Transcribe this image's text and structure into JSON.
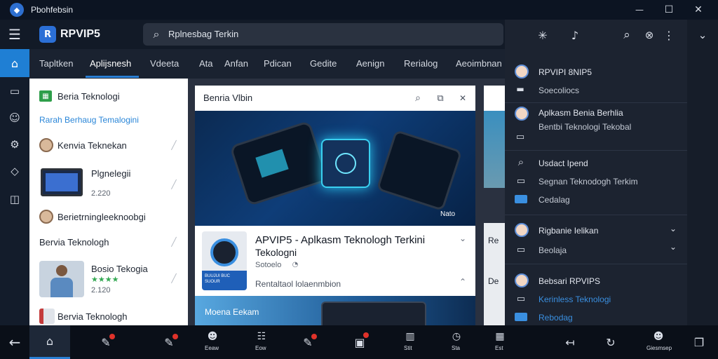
{
  "window": {
    "title": "Pbohfebsin",
    "minimize": "—",
    "maximize": "☐",
    "close": "✕"
  },
  "appbar": {
    "brand": "RPVIP5",
    "search_text": "Rplnesbag Terkin",
    "menu_glyph": "☰"
  },
  "tabs": [
    "Tapltken",
    "Aplijsnesh",
    "Vdeeta",
    "Ata",
    "Anfan",
    "Pdican",
    "Gedite",
    "Aenign",
    "Rerialog",
    "Aeoimbnan"
  ],
  "sidebar": {
    "items": [
      {
        "label": "Beria Teknologi"
      },
      {
        "label": "Rarah Berhaug Temalogini"
      },
      {
        "label": "Kenvia Teknekan"
      },
      {
        "label": "Plgnelegii",
        "meta": "2.220"
      },
      {
        "label": "Berietrningleeknoobgi"
      },
      {
        "label": "Bervia Teknologh"
      },
      {
        "label": "Bosio Tekogia",
        "meta": "2.120"
      },
      {
        "label": "Bervia  Teknologh"
      }
    ]
  },
  "article": {
    "header": "Benria Vlbin",
    "hero_caption": "Nato",
    "title_line1": "APVIP5 - Aplkasm Teknologh Terkini",
    "title_line2": "Tekologni",
    "meta": "Sotoelo",
    "footer_text": "Rentaltaol lolaenmbion",
    "app_icon_text": "BUUJUI BUC SUOUR"
  },
  "next_card": {
    "label": "Moena Eekam"
  },
  "peek_cards": [
    "Re",
    "De"
  ],
  "right_panel": {
    "top_icons": [
      "✳",
      "♪",
      "⌕",
      "⊗",
      "⋮",
      "⌄"
    ],
    "rows": [
      {
        "title": "RPVIPI 8NIP5",
        "sub": "Soecoliocs"
      },
      {
        "title": "Aplkasm Benia Berhlia",
        "sub": "Bentbi Teknologi Tekobal"
      },
      {
        "title": "Usdact Ipend",
        "sub": "Segnan Teknodogh Terkim",
        "sub2": "Cedalag"
      },
      {
        "title": "Rigbanie Ielikan",
        "sub": "Beolaja"
      },
      {
        "title": "Bebsari RPVIPS",
        "sub": "Kerinless Teknologi",
        "sub2": "Rebodag"
      }
    ]
  },
  "bottombar": {
    "labels": [
      "Eeaw",
      "Eow",
      "Stit",
      "Sta",
      "Est",
      "Giesmsep"
    ]
  },
  "colors": {
    "accent": "#2a7fd4",
    "link": "#3a8fe0",
    "badge": "#e0322a"
  }
}
